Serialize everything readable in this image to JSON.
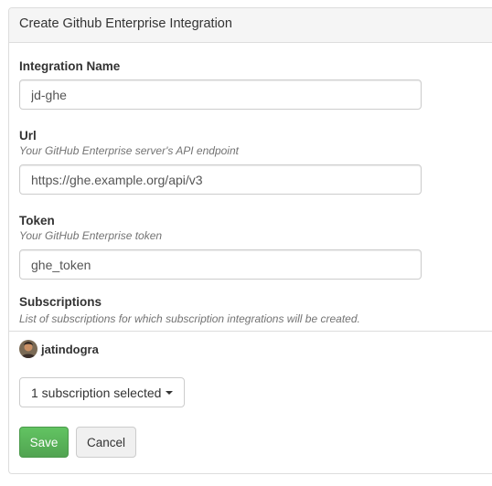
{
  "panel": {
    "title": "Create Github Enterprise Integration"
  },
  "form": {
    "name": {
      "label": "Integration Name",
      "value": "jd-ghe"
    },
    "url": {
      "label": "Url",
      "help": "Your GitHub Enterprise server's API endpoint",
      "value": "https://ghe.example.org/api/v3"
    },
    "token": {
      "label": "Token",
      "help": "Your GitHub Enterprise token",
      "value": "ghe_token"
    },
    "subscriptions": {
      "label": "Subscriptions",
      "help": "List of subscriptions for which subscription integrations will be created.",
      "items": [
        {
          "name": "jatindogra",
          "icon": "user-avatar"
        }
      ],
      "dropdown_label": "1 subscription selected"
    }
  },
  "actions": {
    "save_label": "Save",
    "cancel_label": "Cancel",
    "save_color": "#5cb85c"
  }
}
